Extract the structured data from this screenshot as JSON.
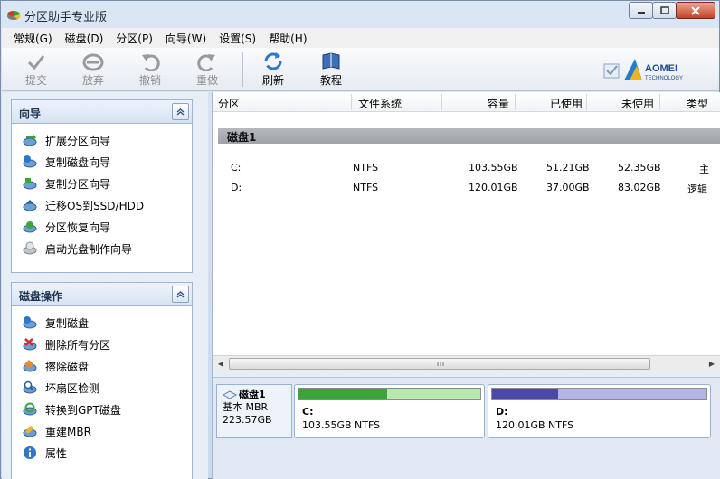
{
  "window": {
    "title": "分区助手专业版"
  },
  "menu": [
    "常规(G)",
    "磁盘(D)",
    "分区(P)",
    "向导(W)",
    "设置(S)",
    "帮助(H)"
  ],
  "toolbar": {
    "submit": "提交",
    "discard": "放弃",
    "undo": "撤销",
    "redo": "重做",
    "refresh": "刷新",
    "tutorial": "教程"
  },
  "logo": {
    "brand": "AOMEI",
    "sub": "TECHNOLOGY"
  },
  "wizard_panel": {
    "title": "向导",
    "items": [
      "扩展分区向导",
      "复制磁盘向导",
      "复制分区向导",
      "迁移OS到SSD/HDD",
      "分区恢复向导",
      "启动光盘制作向导"
    ]
  },
  "disk_ops_panel": {
    "title": "磁盘操作",
    "items": [
      "复制磁盘",
      "删除所有分区",
      "擦除磁盘",
      "坏扇区检测",
      "转换到GPT磁盘",
      "重建MBR",
      "属性"
    ]
  },
  "table": {
    "headers": [
      "分区",
      "文件系统",
      "容量",
      "已使用",
      "未使用",
      "类型"
    ],
    "disk_label": "磁盘1",
    "rows": [
      {
        "partition": "C:",
        "fs": "NTFS",
        "capacity": "103.55GB",
        "used": "51.21GB",
        "unused": "52.35GB",
        "type": "主"
      },
      {
        "partition": "D:",
        "fs": "NTFS",
        "capacity": "120.01GB",
        "used": "37.00GB",
        "unused": "83.02GB",
        "type": "逻辑"
      }
    ]
  },
  "disk_map": {
    "disk_name": "磁盘1",
    "disk_type": "基本 MBR",
    "disk_size": "223.57GB",
    "partitions": [
      {
        "label": "C:",
        "info": "103.55GB NTFS",
        "used_fraction": 0.49,
        "color": "#3aa53a"
      },
      {
        "label": "D:",
        "info": "120.01GB NTFS",
        "used_fraction": 0.31,
        "color": "#4a4aa6"
      }
    ]
  }
}
